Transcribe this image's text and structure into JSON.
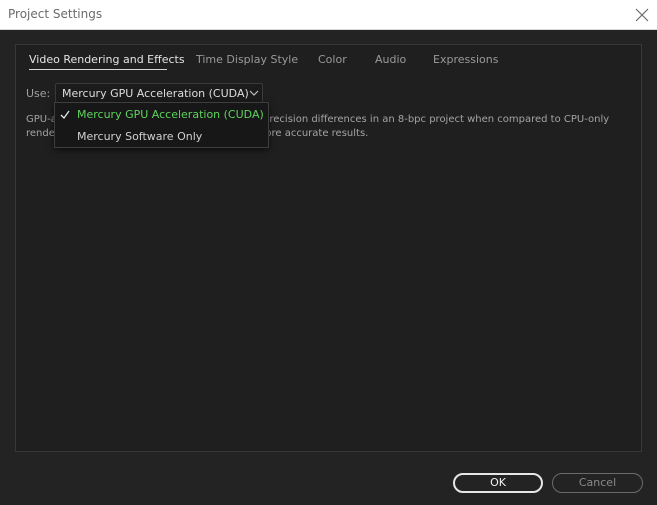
{
  "window": {
    "title": "Project Settings",
    "close_icon": "close-icon"
  },
  "tabs": [
    {
      "label": "Video Rendering and Effects",
      "active": true
    },
    {
      "label": "Time Display Style",
      "active": false
    },
    {
      "label": "Color",
      "active": false
    },
    {
      "label": "Audio",
      "active": false
    },
    {
      "label": "Expressions",
      "active": false
    }
  ],
  "renderer": {
    "label": "Use:",
    "selected": "Mercury GPU Acceleration (CUDA)",
    "chevron_icon": "chevron-down-icon",
    "description": "GPU-accelerated rendering may produce small precision differences in an 8-bpc project when compared to CPU-only rendering. Use a 16-bpc or 32-bpc project for more accurate results.",
    "options": [
      {
        "label": "Mercury GPU Acceleration (CUDA)",
        "checked": true
      },
      {
        "label": "Mercury Software Only",
        "checked": false
      }
    ]
  },
  "buttons": {
    "ok": "OK",
    "cancel": "Cancel"
  },
  "colors": {
    "background": "#232323",
    "selected_option": "#5fd35f",
    "text": "#b8b8b8"
  }
}
